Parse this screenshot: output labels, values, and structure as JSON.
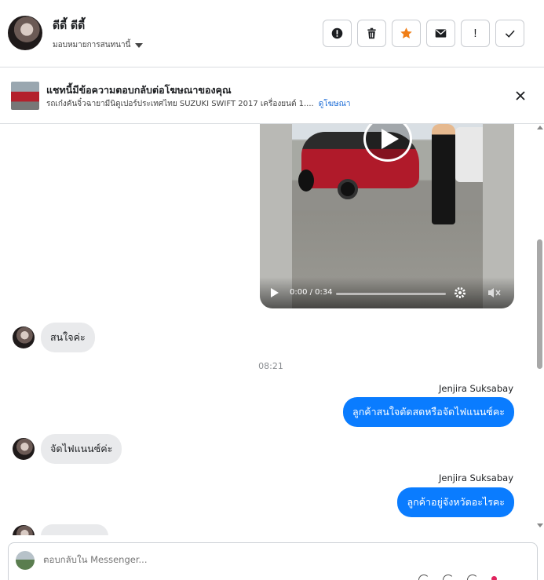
{
  "header": {
    "contact_name": "ดีดี้ ดีดี้",
    "assign_label": "มอบหมายการสนทนานี้",
    "toolbar": {
      "spam_icon": "exclamation-circle-icon",
      "delete_icon": "trash-icon",
      "star_icon": "star-icon",
      "unread_icon": "envelope-icon",
      "followup_label": "!",
      "done_icon": "check-icon"
    },
    "star_color": "#f07e16"
  },
  "ad_banner": {
    "title": "แชทนี้มีข้อความตอบกลับต่อโฆษณาของคุณ",
    "subtitle": "รถเก๋งคันจิ๋วฉายามีนิดูเปอร์ประเทศไทย SUZUKI SWIFT 2017 เครื่องยนต์ 1....",
    "link": "ดูโฆษณา",
    "close_icon": "close-icon"
  },
  "video": {
    "time": "0:00 / 0:34"
  },
  "messages": {
    "m1": "สนใจค่ะ",
    "timestamp": "08:21",
    "sender1": "Jenjira Suksabay",
    "m2": "ลูกค้าสนใจตัดสดหรือจัดไฟแนนซ์คะ",
    "m3": "จัดไฟแนนซ์ค่ะ",
    "sender2": "Jenjira Suksabay",
    "m4": "ลูกค้าอยู่จังหวัดอะไรคะ"
  },
  "composer": {
    "placeholder": "ตอบกลับใน Messenger..."
  },
  "colors": {
    "accent": "#0a7cff",
    "link": "#1a6bd6",
    "incoming_bubble": "#e9eaec"
  }
}
